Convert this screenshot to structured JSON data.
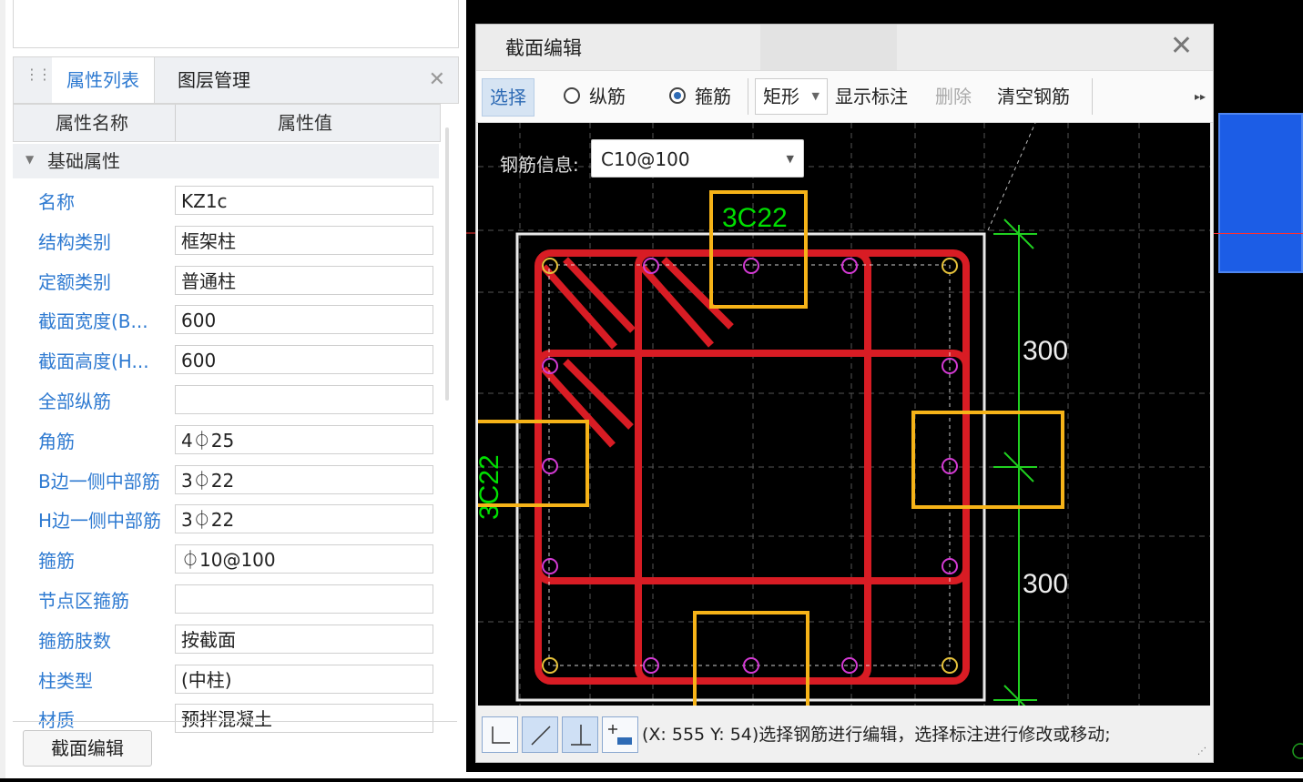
{
  "panel": {
    "tabs": [
      {
        "label": "属性列表",
        "active": true
      },
      {
        "label": "图层管理",
        "active": false
      }
    ],
    "table_headers": {
      "name": "属性名称",
      "value": "属性值"
    },
    "group": "基础属性",
    "rows": [
      {
        "name": "名称",
        "value": "KZ1c"
      },
      {
        "name": "结构类别",
        "value": "框架柱"
      },
      {
        "name": "定额类别",
        "value": "普通柱"
      },
      {
        "name": "截面宽度(B...",
        "value": "600"
      },
      {
        "name": "截面高度(H...",
        "value": "600"
      },
      {
        "name": "全部纵筋",
        "value": ""
      },
      {
        "name": "角筋",
        "value": "4⏀25"
      },
      {
        "name": "B边一侧中部筋",
        "value": "3⏀22"
      },
      {
        "name": "H边一侧中部筋",
        "value": "3⏀22"
      },
      {
        "name": "箍筋",
        "value": "⏀10@100"
      },
      {
        "name": "节点区箍筋",
        "value": ""
      },
      {
        "name": "箍筋肢数",
        "value": "按截面"
      },
      {
        "name": "柱类型",
        "value": "(中柱)"
      },
      {
        "name": "材质",
        "value": "预拌混凝土"
      }
    ],
    "edit_button": "截面编辑"
  },
  "dialog": {
    "title": "截面编辑",
    "toolbar": {
      "select": "选择",
      "longitudinal": "纵筋",
      "stirrup": "箍筋",
      "shape": "矩形",
      "show_label": "显示标注",
      "delete": "删除",
      "clear": "清空钢筋"
    },
    "rebar_info_label": "钢筋信息:",
    "rebar_info_value": "C10@100",
    "labels": {
      "top": "3C22",
      "left": "3C22"
    },
    "dims": {
      "upper": "300",
      "lower": "300"
    },
    "status": "(X: 555 Y: 54)选择钢筋进行编辑，选择标注进行修改或移动;"
  },
  "colors": {
    "rebar": "#d81c24",
    "highlight": "#f6b318",
    "label_green": "#00e000",
    "accent_blue": "#2e7ad1"
  }
}
